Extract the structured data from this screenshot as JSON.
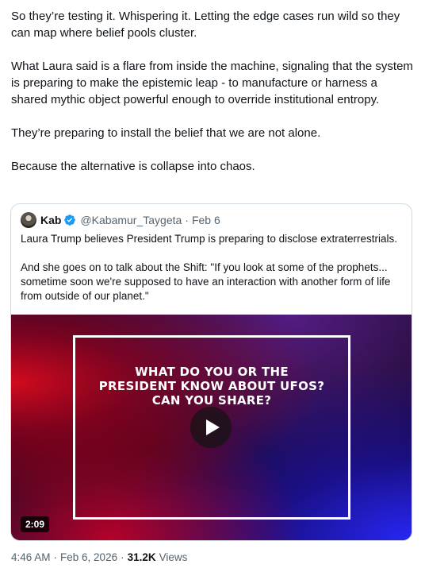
{
  "tweet": {
    "paragraphs": [
      "So they’re testing it. Whispering it. Letting the edge cases run wild so they can map where belief pools cluster.",
      "What Laura said is a flare from inside the machine, signaling that the system is preparing to make the epistemic leap - to manufacture or harness a shared mythic object powerful enough to override institutional entropy.",
      "They’re preparing to install the belief that we are not alone.",
      "Because the alternative is collapse into chaos."
    ]
  },
  "quoted": {
    "name": "Kab",
    "handle": "@Kabamur_Taygeta",
    "separator": "·",
    "date": "Feb 6",
    "paragraphs": [
      "Laura Trump believes President Trump is preparing to disclose extraterrestrials.",
      "And she goes on to talk about the Shift: \"If you look at some of the prophets... sometime soon we're supposed to have an interaction with another form of life from outside of our planet.\""
    ],
    "media": {
      "headline": "WHAT DO YOU OR THE PRESIDENT KNOW ABOUT UFOS? CAN YOU SHARE?",
      "duration": "2:09"
    }
  },
  "meta": {
    "time": "4:46 AM",
    "date": "Feb 6, 2026",
    "separator": "·",
    "views_count": "31.2K",
    "views_label": "Views"
  },
  "colors": {
    "text": "#0f1419",
    "secondary_text": "#536471",
    "border": "#cfd9de",
    "verified_blue": "#1d9bf0"
  },
  "icons": {
    "verified": "verified-badge-icon",
    "play": "play-icon"
  }
}
